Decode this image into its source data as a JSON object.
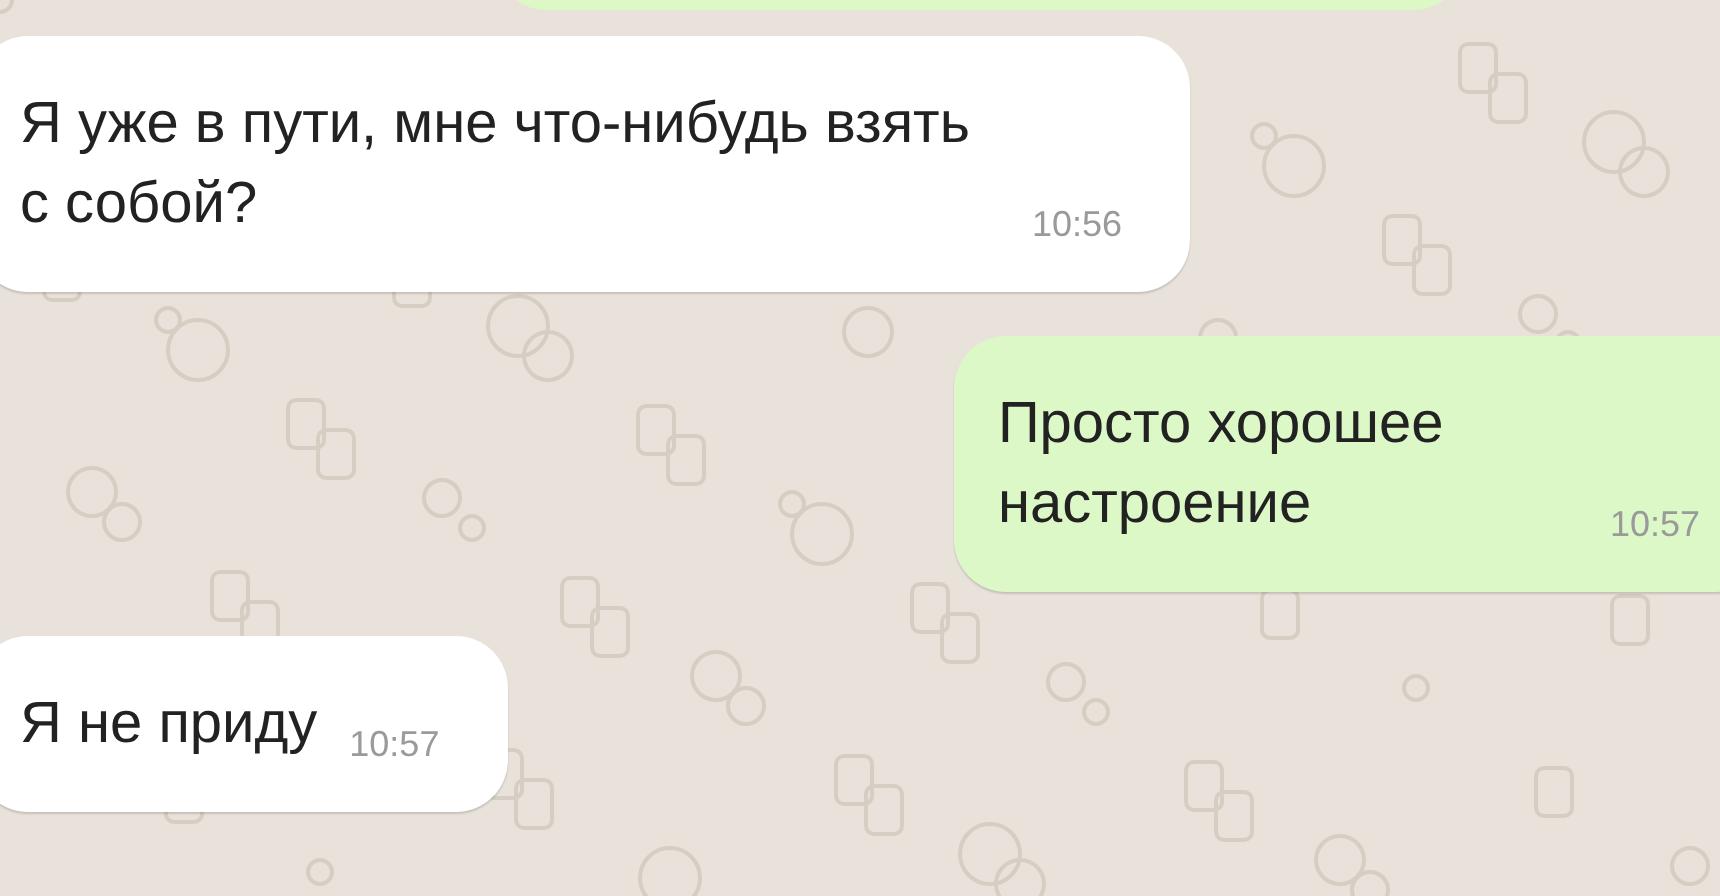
{
  "messages": [
    {
      "kind": "incoming",
      "text": "Я уже в пути, мне что-нибудь взять с собой?",
      "time": "10:56"
    },
    {
      "kind": "outgoing",
      "text": "Просто хорошее настроение",
      "time": "10:57"
    },
    {
      "kind": "incoming",
      "text": "Я не приду",
      "time": "10:57"
    }
  ]
}
